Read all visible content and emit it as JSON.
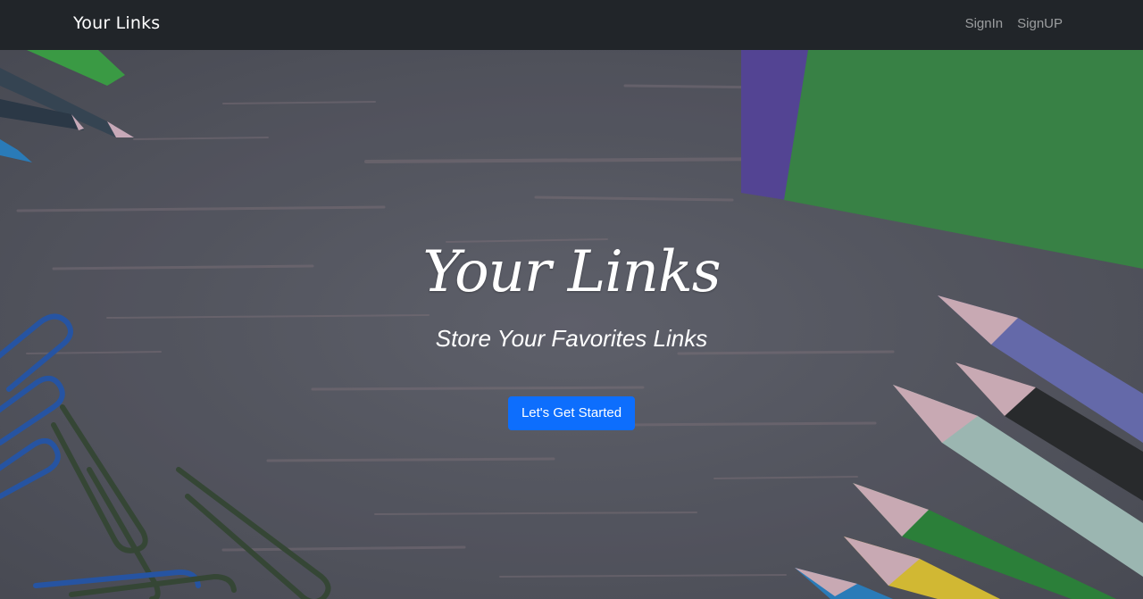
{
  "navbar": {
    "brand": "Your Links",
    "links": [
      {
        "label": "SignIn"
      },
      {
        "label": "SignUP"
      }
    ]
  },
  "hero": {
    "title": "Your Links",
    "subtitle": "Store Your Favorites Links",
    "cta_label": "Let's Get Started"
  },
  "colors": {
    "navbar_bg": "#212529",
    "cta_bg": "#0d6efd",
    "notebook_green": "#3d8c4b",
    "desk_gray": "#5c5e69"
  },
  "icons": {
    "background": "desk-with-pencils-and-paperclips"
  }
}
